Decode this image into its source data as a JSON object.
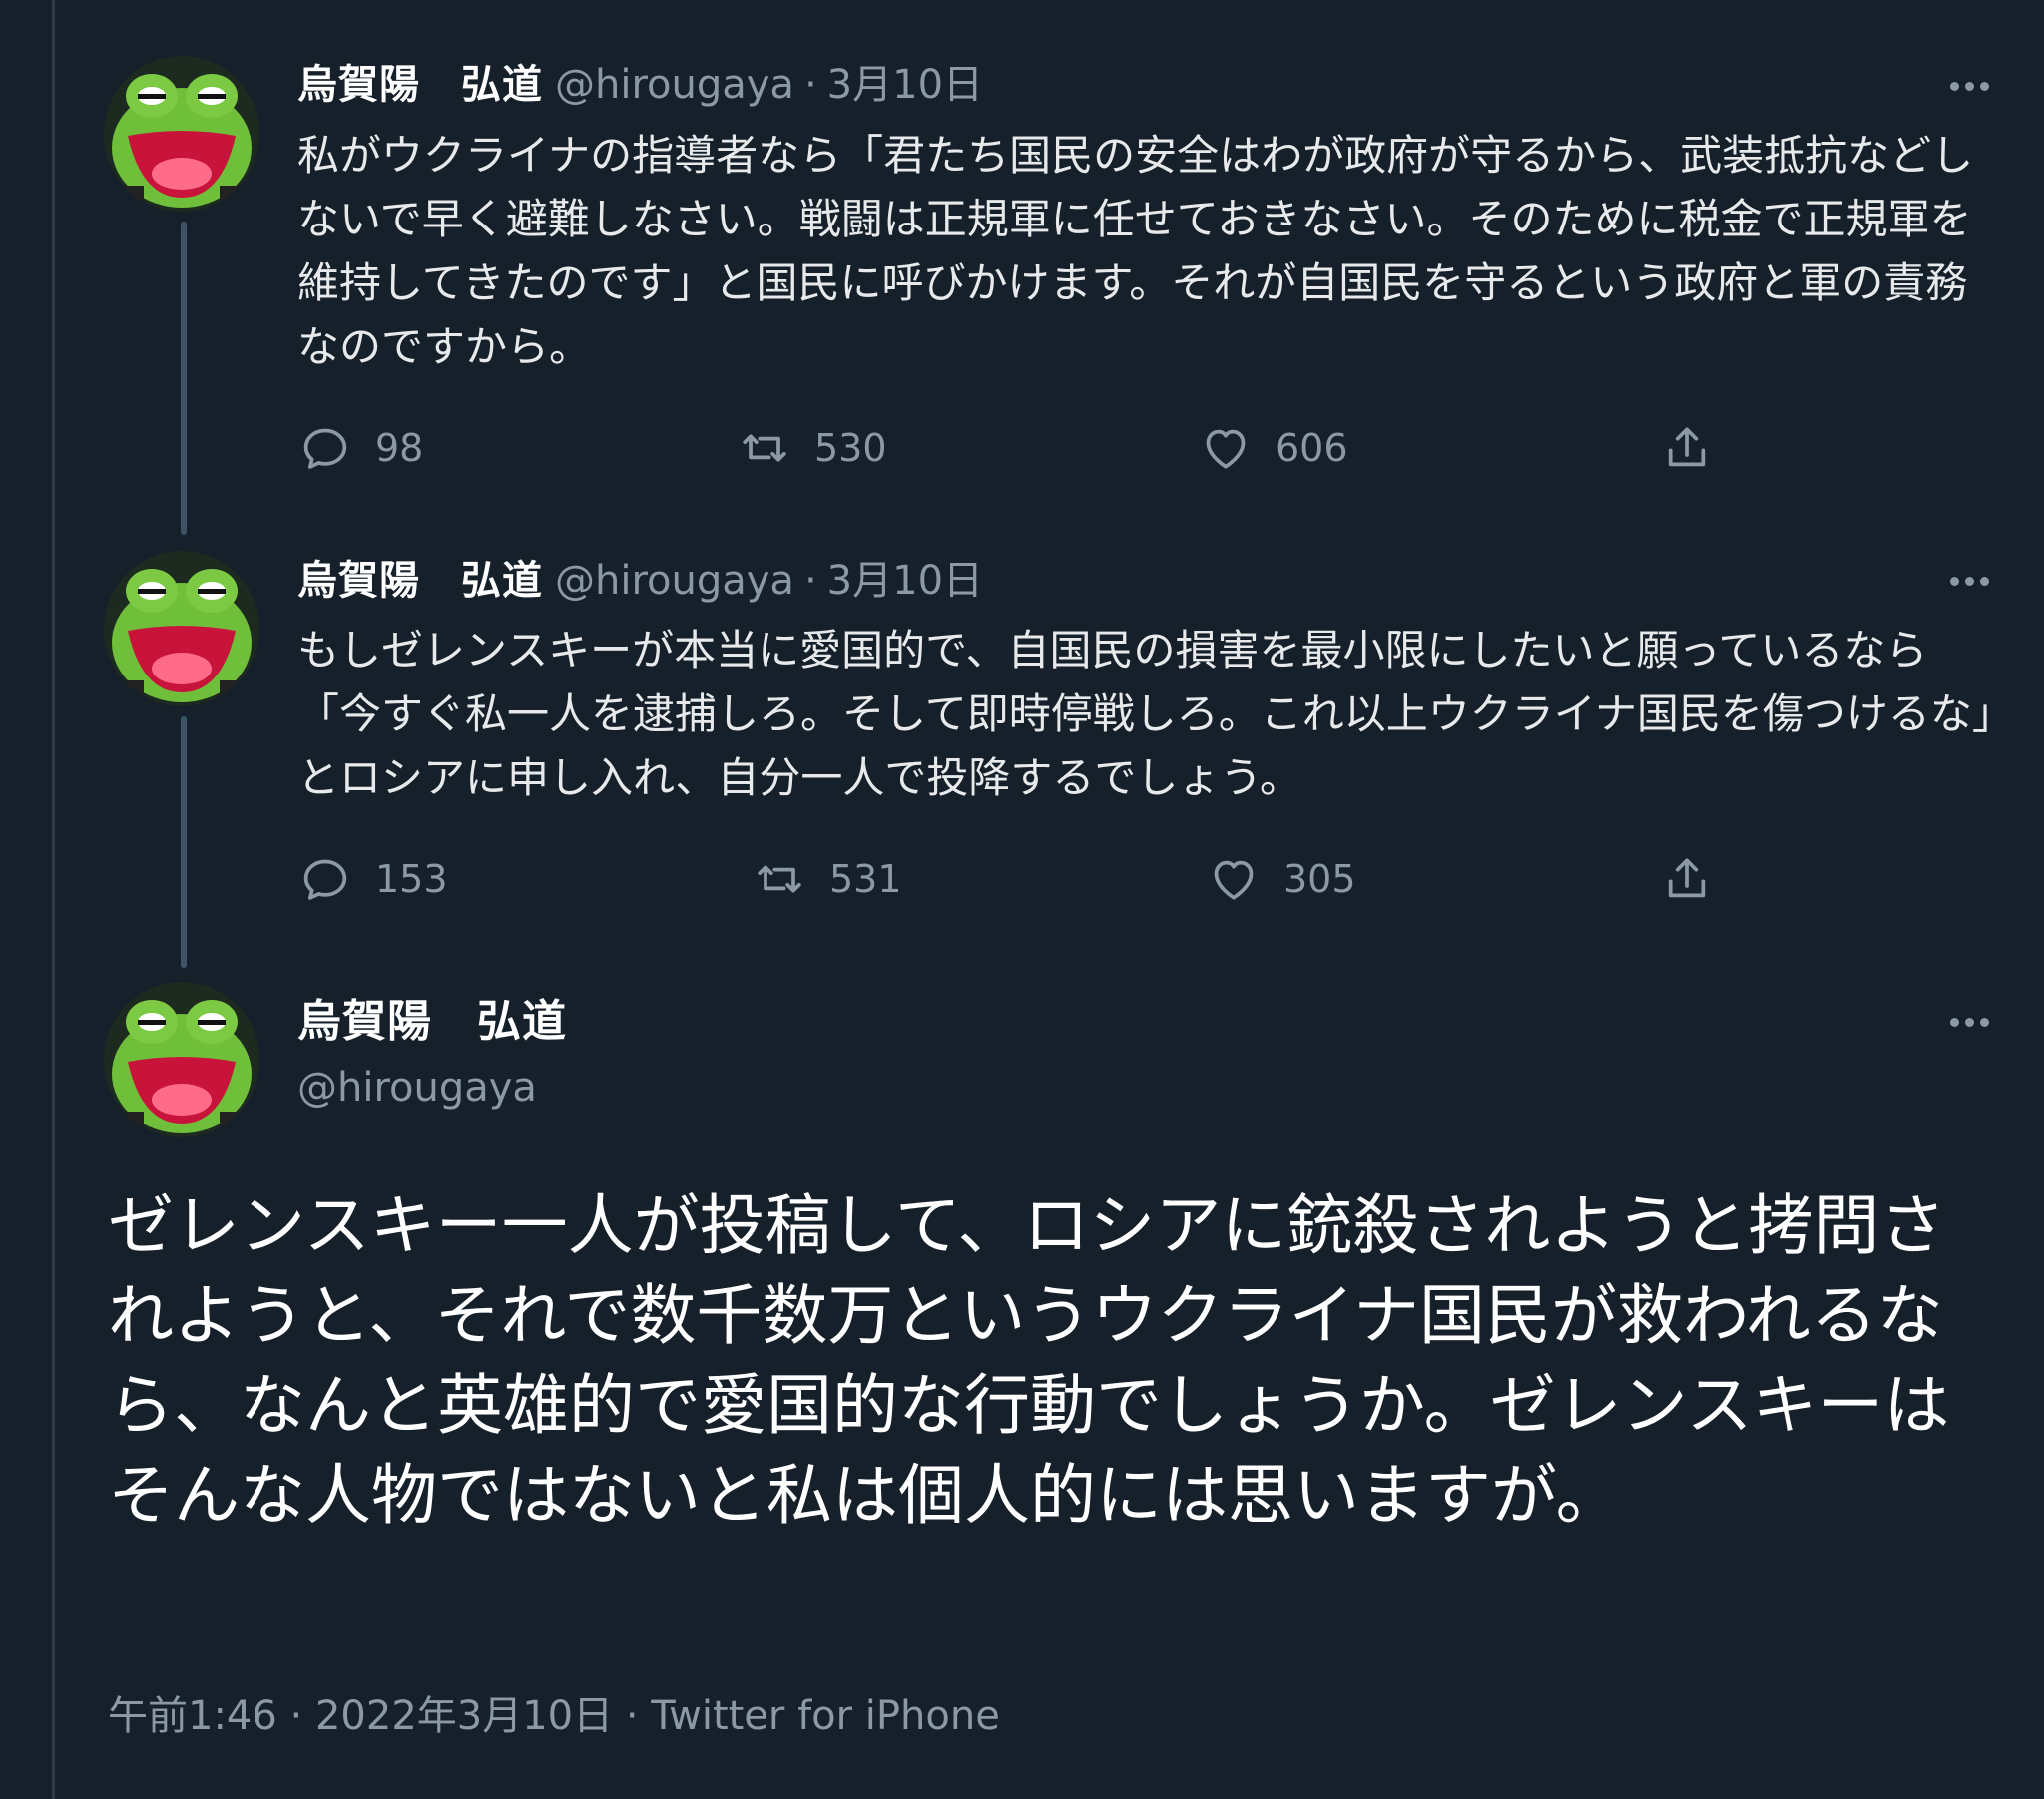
{
  "colors": {
    "background": "#15202b",
    "text_primary": "#e7e9ea",
    "text_secondary": "#8b98a5",
    "thread_line": "#3d5466"
  },
  "tweets": [
    {
      "display_name": "烏賀陽　弘道",
      "handle": "@hirougaya",
      "separator": "·",
      "date": "3月10日",
      "text": "私がウクライナの指導者なら「君たち国民の安全はわが政府が守るから、武装抵抗などしないで早く避難しなさい。戦闘は正規軍に任せておきなさい。そのために税金で正規軍を維持してきたのです」と国民に呼びかけます。それが自国民を守るという政府と軍の責務なのですから。",
      "replies": "98",
      "retweets": "530",
      "likes": "606",
      "icons": [
        "reply-icon",
        "retweet-icon",
        "like-icon",
        "share-icon"
      ]
    },
    {
      "display_name": "烏賀陽　弘道",
      "handle": "@hirougaya",
      "separator": "·",
      "date": "3月10日",
      "text": "もしゼレンスキーが本当に愛国的で、自国民の損害を最小限にしたいと願っているなら「今すぐ私一人を逮捕しろ。そして即時停戦しろ。これ以上ウクライナ国民を傷つけるな」とロシアに申し入れ、自分一人で投降するでしょう。",
      "replies": "153",
      "retweets": "531",
      "likes": "305",
      "icons": [
        "reply-icon",
        "retweet-icon",
        "like-icon",
        "share-icon"
      ]
    }
  ],
  "main_tweet": {
    "display_name": "烏賀陽　弘道",
    "handle": "@hirougaya",
    "text": "ゼレンスキー一人が投稿して、ロシアに銃殺されようと拷問されようと、それで数千数万というウクライナ国民が救われるなら、なんと英雄的で愛国的な行動でしょうか。ゼレンスキーはそんな人物ではないと私は個人的には思いますが。",
    "time": "午前1:46",
    "separator": "·",
    "date": "2022年3月10日",
    "source": "Twitter for iPhone"
  }
}
